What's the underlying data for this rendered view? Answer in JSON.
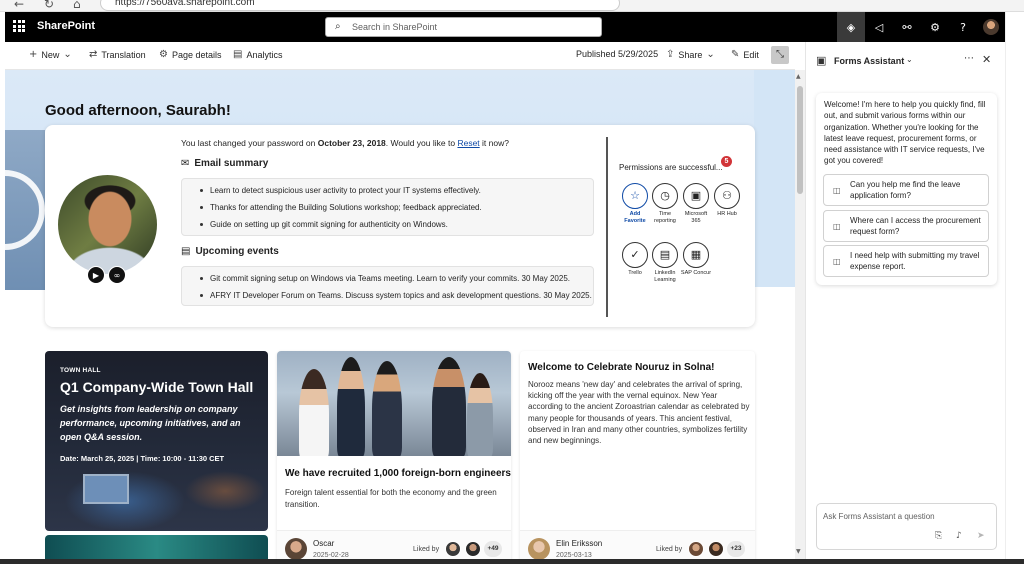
{
  "browser": {
    "url": "https://7560ava.sharepoint.com",
    "back_icon": "←",
    "refresh_icon": "↻",
    "home_icon": "⌂"
  },
  "suitebar": {
    "app_name": "SharePoint",
    "search_placeholder": "Search in SharePoint"
  },
  "commandbar": {
    "new": "New",
    "translation": "Translation",
    "page_details": "Page details",
    "analytics": "Analytics",
    "published": "Published 5/29/2025",
    "share": "Share",
    "edit": "Edit"
  },
  "hero": {
    "greeting": "Good afternoon, Saurabh!"
  },
  "profile_card": {
    "password_pre": "You last changed your password on ",
    "password_date": "October 23, 2018",
    "password_mid": ". Would you like to ",
    "password_link": "Reset",
    "password_post": " it now?",
    "email_title": "Email summary",
    "email_items": [
      "Learn to detect suspicious user activity to protect your IT systems effectively.",
      "Thanks for attending the Building Solutions workshop; feedback appreciated.",
      "Guide on setting up git commit signing for authenticity on Windows."
    ],
    "events_title": "Upcoming events",
    "event_items": [
      "Git commit signing setup on Windows via Teams meeting. Learn to verify your commits. 30 May 2025.",
      "AFRY IT Developer Forum on Teams. Discuss system topics and ask development questions. 30 May 2025."
    ],
    "permissions_label": "Permissions are successful...",
    "permissions_badge": "5",
    "apps": [
      {
        "label": "Add Favorite",
        "glyph": "☆"
      },
      {
        "label": "Time reporting",
        "glyph": "◷"
      },
      {
        "label": "Microsoft 365",
        "glyph": "▣"
      },
      {
        "label": "HR Hub",
        "glyph": "⚇"
      },
      {
        "label": "Trello",
        "glyph": "✓"
      },
      {
        "label": "LinkedIn Learning",
        "glyph": "▤"
      },
      {
        "label": "SAP Concur",
        "glyph": "▦"
      }
    ]
  },
  "news": {
    "townhall": {
      "kicker": "TOWN HALL",
      "title": "Q1 Company-Wide Town Hall",
      "subtitle": "Get insights from leadership on company performance, upcoming initiatives, and an open Q&A session.",
      "date": "Date: March 25, 2025 | Time: 10:00 - 11:30 CET"
    },
    "recruit": {
      "title": "We have recruited 1,000 foreign-born engineers",
      "subtitle": "Foreign talent essential for both the economy and the green transition.",
      "author": "Oscar",
      "date": "2025-02-28",
      "liked_by": "Liked by",
      "count": "+49"
    },
    "nouruz": {
      "title": "Welcome to Celebrate Nouruz in Solna!",
      "body": "Norooz means 'new day' and celebrates the arrival of spring, kicking off the year with the vernal equinox. New Year according to the ancient Zoroastrian calendar as celebrated by many people for thousands of years. This ancient festival, observed in Iran and many other countries, symbolizes fertility and new beginnings.",
      "author": "Elin Eriksson",
      "date": "2025-03-13",
      "liked_by": "Liked by",
      "count": "+23"
    }
  },
  "assistant": {
    "title": "Forms Assistant",
    "welcome": "Welcome! I'm here to help you quickly find, fill out, and submit various forms within our organization. Whether you're looking for the latest leave request, procurement forms, or need assistance with IT service requests, I've got you covered!",
    "suggestions": [
      "Can you help me find the leave application form?",
      "Where can I access the procurement request form?",
      "I need help with submitting my travel expense report."
    ],
    "input_placeholder": "Ask Forms Assistant a question"
  },
  "colors": {
    "suitebar_bg": "#000000",
    "link": "#0f4aa6",
    "badge_red": "#d13438",
    "hero_bg": "#dbe9f7"
  },
  "icons": [
    "search-icon",
    "waffle-icon",
    "copilot-icon",
    "megaphone-icon",
    "share-network-icon",
    "gear-icon",
    "help-icon",
    "chevron-down-icon",
    "close-icon",
    "more-icon",
    "mail-icon",
    "calendar-icon",
    "attach-icon",
    "mic-icon",
    "send-icon",
    "chat-icon"
  ]
}
